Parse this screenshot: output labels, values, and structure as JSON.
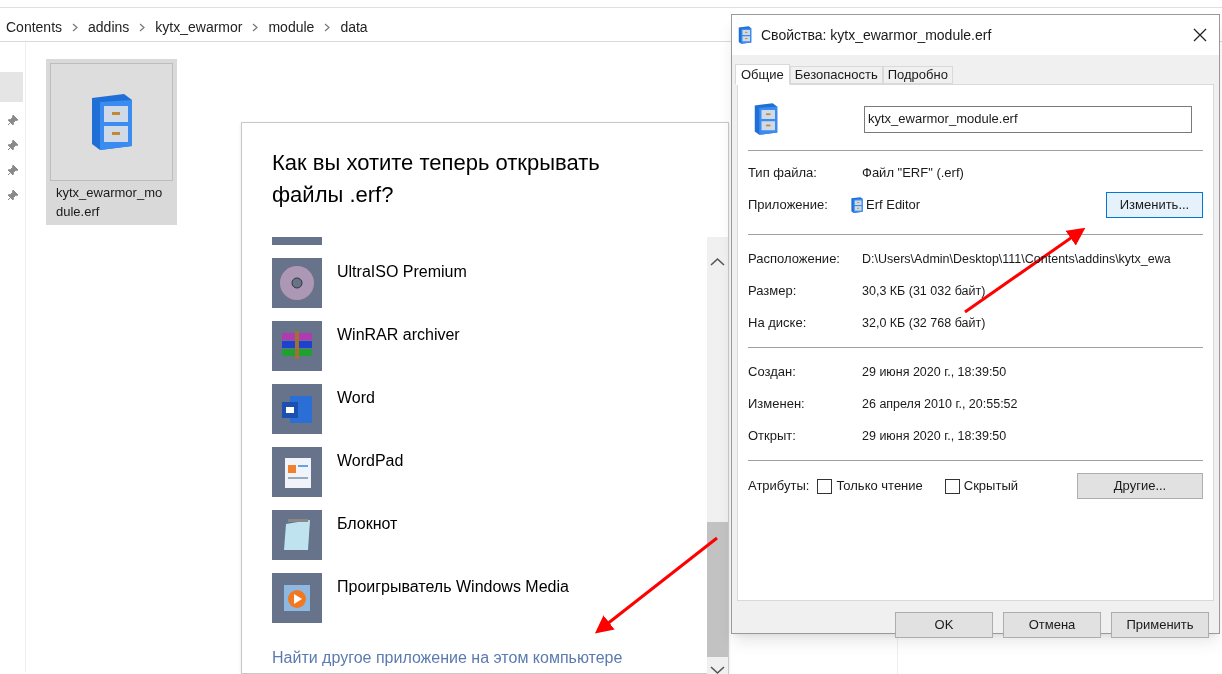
{
  "explorer": {
    "breadcrumb": [
      "Contents",
      "addins",
      "kytx_ewarmor",
      "module",
      "data"
    ],
    "file": {
      "name": "kytx_ewarmor_module.erf",
      "selected": true
    }
  },
  "open_with": {
    "title": "Как вы хотите теперь открывать файлы .erf?",
    "apps": [
      {
        "name": "UltraISO Premium",
        "kind": "disc"
      },
      {
        "name": "WinRAR archiver",
        "kind": "archive"
      },
      {
        "name": "Word",
        "kind": "word"
      },
      {
        "name": "WordPad",
        "kind": "wordpad"
      },
      {
        "name": "Блокнот",
        "kind": "notepad"
      },
      {
        "name": "Проигрыватель Windows Media",
        "kind": "media"
      }
    ],
    "link": "Найти другое приложение на этом компьютере"
  },
  "properties": {
    "title": "Свойства: kytx_ewarmor_module.erf",
    "tabs": [
      {
        "label": "Общие",
        "selected": true
      },
      {
        "label": "Безопасность",
        "selected": false
      },
      {
        "label": "Подробно",
        "selected": false
      }
    ],
    "file_name": "kytx_ewarmor_module.erf",
    "file_type": {
      "label": "Тип файла:",
      "value": "Файл \"ERF\" (.erf)"
    },
    "application": {
      "label": "Приложение:",
      "value": "Erf Editor",
      "button": "Изменить..."
    },
    "location_group": [
      {
        "label": "Расположение:",
        "value": "D:\\Users\\Admin\\Desktop\\111\\Contents\\addins\\kytx_ewa"
      },
      {
        "label": "Размер:",
        "value": "30,3 КБ (31 032 байт)"
      },
      {
        "label": "На диске:",
        "value": "32,0 КБ (32 768 байт)"
      }
    ],
    "dates_group": [
      {
        "label": "Создан:",
        "value": "29 июня 2020 г., 18:39:50"
      },
      {
        "label": "Изменен:",
        "value": "26 апреля 2010 г., 20:55:52"
      },
      {
        "label": "Открыт:",
        "value": "29 июня 2020 г., 18:39:50"
      }
    ],
    "attributes": {
      "label": "Атрибуты:",
      "checkboxes": [
        {
          "label": "Только чтение",
          "checked": false
        },
        {
          "label": "Скрытый",
          "checked": false
        }
      ],
      "button": "Другие..."
    },
    "buttons": [
      "OK",
      "Отмена",
      "Применить"
    ]
  }
}
